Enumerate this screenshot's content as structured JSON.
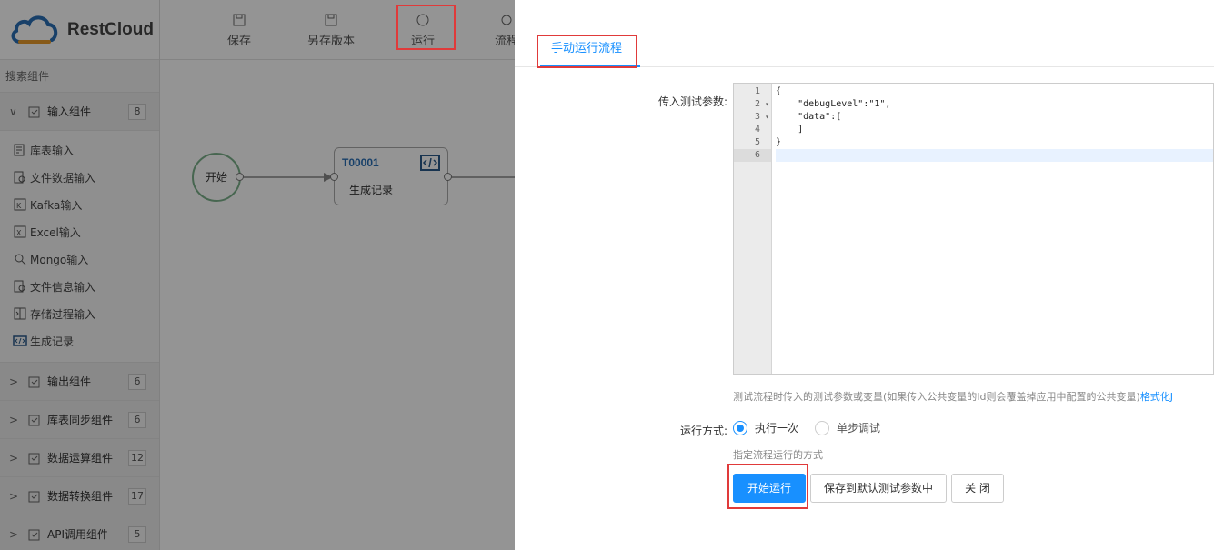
{
  "app": {
    "logo_text": "RestCloud"
  },
  "toolbar": {
    "save": "保存",
    "save_version": "另存版本",
    "run": "运行",
    "flow_partial": "流程"
  },
  "sidebar": {
    "search_label": "搜索组件",
    "groups": [
      {
        "label": "输入组件",
        "count": "8",
        "expanded": true
      },
      {
        "label": "输出组件",
        "count": "6"
      },
      {
        "label": "库表同步组件",
        "count": "6"
      },
      {
        "label": "数据运算组件",
        "count": "12"
      },
      {
        "label": "数据转换组件",
        "count": "17"
      },
      {
        "label": "API调用组件",
        "count": "5"
      }
    ],
    "input_items": [
      {
        "label": "库表输入",
        "icon": "table-input-icon"
      },
      {
        "label": "文件数据输入",
        "icon": "file-search-icon"
      },
      {
        "label": "Kafka输入",
        "icon": "kafka-icon"
      },
      {
        "label": "Excel输入",
        "icon": "excel-icon"
      },
      {
        "label": "Mongo输入",
        "icon": "mongo-icon"
      },
      {
        "label": "文件信息输入",
        "icon": "file-info-icon"
      },
      {
        "label": "存储过程输入",
        "icon": "procedure-icon"
      },
      {
        "label": "生成记录",
        "icon": "code-icon"
      }
    ]
  },
  "canvas": {
    "start_label": "开始",
    "node": {
      "id": "T00001",
      "name": "生成记录"
    }
  },
  "dialog": {
    "tab_label": "手动运行流程",
    "params_label": "传入测试参数:",
    "editor": {
      "line_numbers": [
        "1",
        "2",
        "3",
        "4",
        "5",
        "6"
      ],
      "lines": [
        "{",
        "    \"debugLevel\":\"1\",",
        "    \"data\":[",
        "    ]",
        "}",
        ""
      ]
    },
    "params_hint": "测试流程时传入的测试参数或变量(如果传入公共变量的Id则会覆盖掉应用中配置的公共变量)",
    "format_link": "格式化J",
    "run_mode_label": "运行方式:",
    "run_mode_options": [
      "执行一次",
      "单步调试"
    ],
    "run_mode_selected": "执行一次",
    "run_mode_hint": "指定流程运行的方式",
    "buttons": {
      "start": "开始运行",
      "save_default": "保存到默认测试参数中",
      "close": "关 闭"
    }
  },
  "colors": {
    "accent": "#1890ff",
    "highlight": "#e03a3a"
  }
}
